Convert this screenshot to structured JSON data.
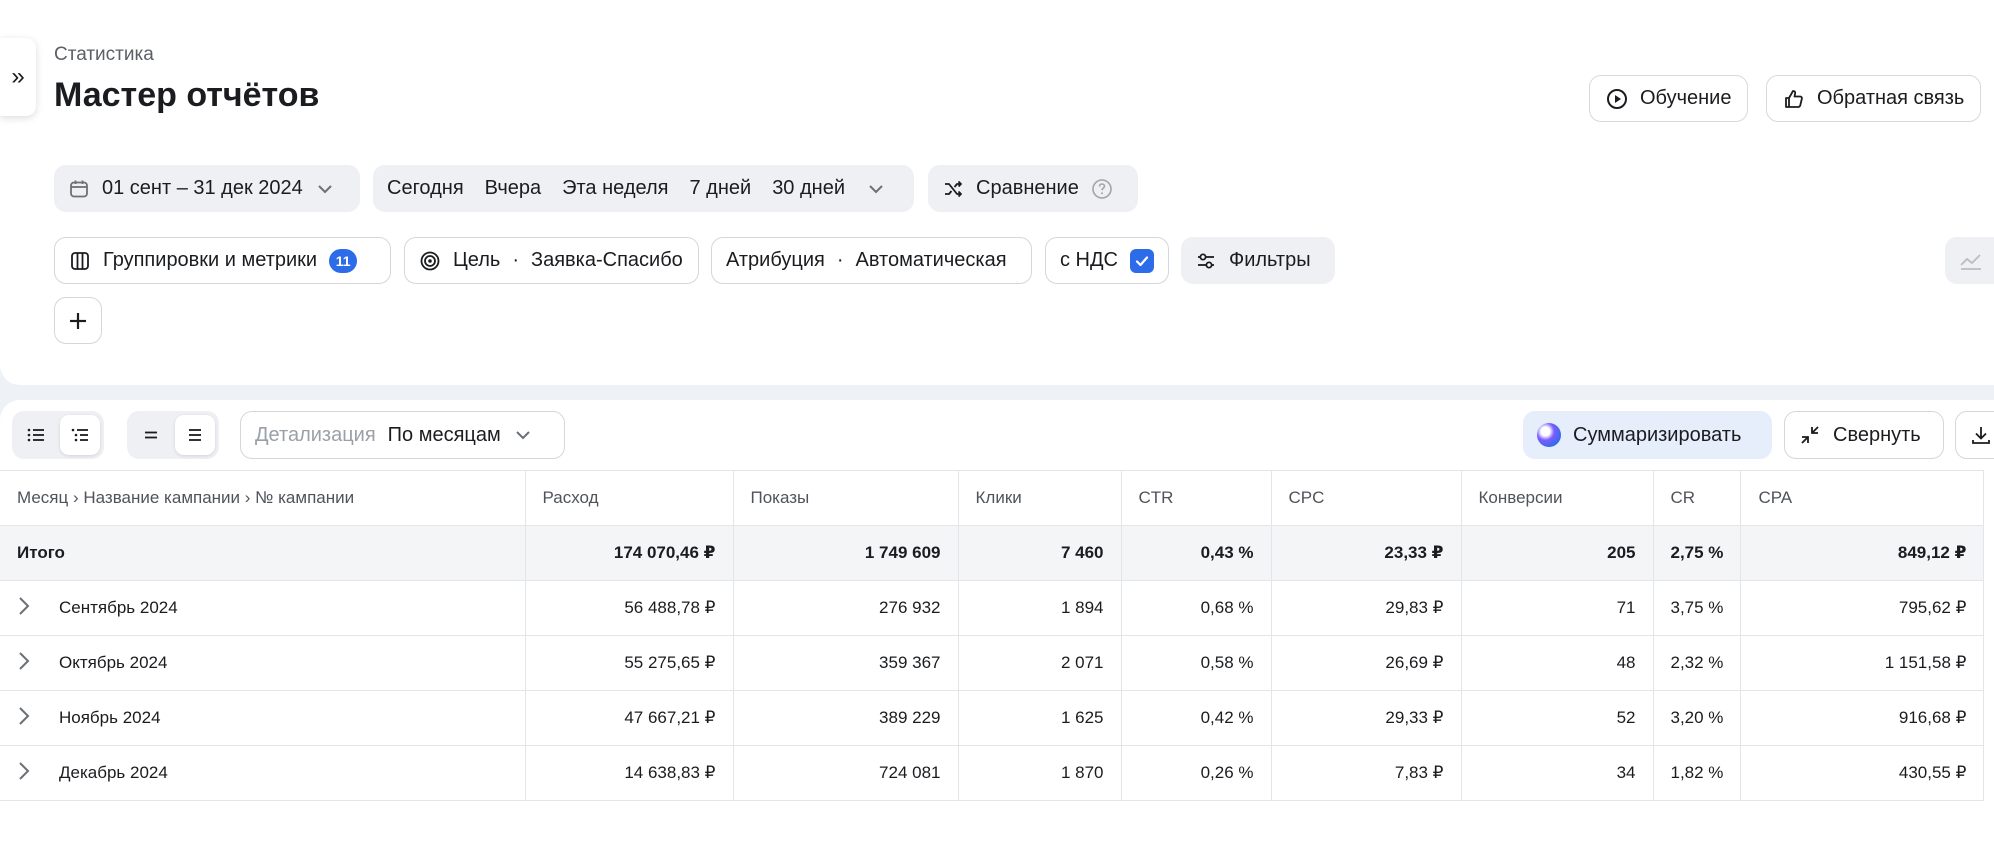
{
  "header": {
    "breadcrumb": "Статистика",
    "title": "Мастер отчётов",
    "learning_label": "Обучение",
    "feedback_label": "Обратная связь"
  },
  "period": {
    "range": "01 сент – 31 дек 2024",
    "presets": [
      "Сегодня",
      "Вчера",
      "Эта неделя",
      "7 дней",
      "30 дней"
    ],
    "compare_label": "Сравнение"
  },
  "filters": {
    "groupings_label": "Группировки и метрики",
    "groupings_count": "11",
    "goal_label": "Цель",
    "goal_value": "Заявка-Спасибо",
    "attribution_label": "Атрибуция",
    "attribution_value": "Автоматическая",
    "vat_label": "с НДС",
    "vat_checked": true,
    "filters_label": "Фильтры",
    "separator": "·"
  },
  "toolbar": {
    "detail_label": "Детализация",
    "detail_value": "По месяцам",
    "summarize_label": "Суммаризировать",
    "collapse_label": "Свернуть"
  },
  "table": {
    "columns": [
      "Месяц › Название кампании › № кампании",
      "Расход",
      "Показы",
      "Клики",
      "CTR",
      "CPC",
      "Конверсии",
      "CR",
      "CPA"
    ],
    "total": [
      "Итого",
      "174 070,46 ₽",
      "1 749 609",
      "7 460",
      "0,43 %",
      "23,33 ₽",
      "205",
      "2,75 %",
      "849,12 ₽"
    ],
    "rows": [
      [
        "Сентябрь 2024",
        "56 488,78 ₽",
        "276 932",
        "1 894",
        "0,68 %",
        "29,83 ₽",
        "71",
        "3,75 %",
        "795,62 ₽"
      ],
      [
        "Октябрь 2024",
        "55 275,65 ₽",
        "359 367",
        "2 071",
        "0,58 %",
        "26,69 ₽",
        "48",
        "2,32 %",
        "1 151,58 ₽"
      ],
      [
        "Ноябрь 2024",
        "47 667,21 ₽",
        "389 229",
        "1 625",
        "0,42 %",
        "29,33 ₽",
        "52",
        "3,20 %",
        "916,68 ₽"
      ],
      [
        "Декабрь 2024",
        "14 638,83 ₽",
        "724 081",
        "1 870",
        "0,26 %",
        "7,83 ₽",
        "34",
        "1,82 %",
        "430,55 ₽"
      ]
    ]
  },
  "colors": {
    "accent": "#2d6ce8",
    "panel_bg": "#eef1f5"
  }
}
